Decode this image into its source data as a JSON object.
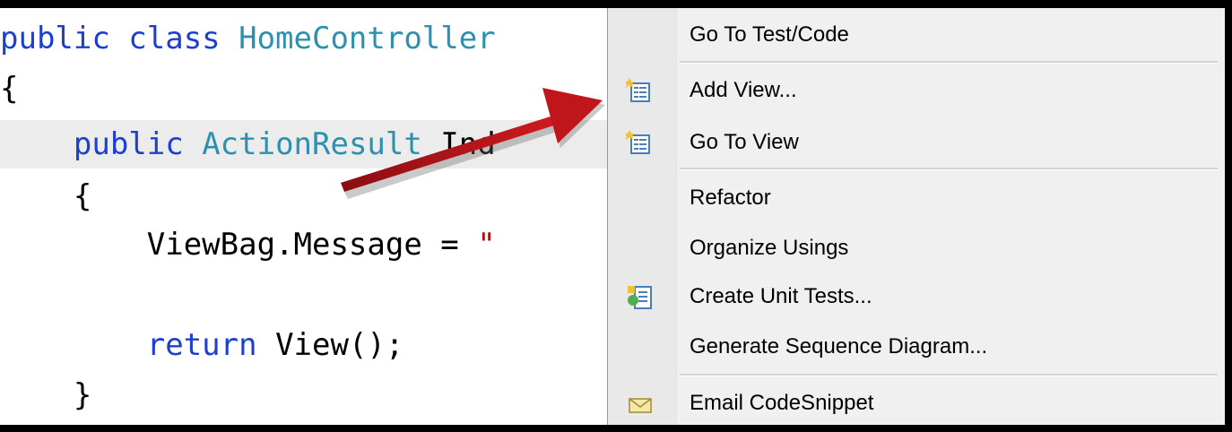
{
  "code": {
    "line1_kw": "public class ",
    "line1_type": "HomeControlle",
    "line1_rest": "r",
    "line2": "{",
    "line3_indent": "    ",
    "line3_kw": "public ",
    "line3_type": "ActionResult",
    "line3_rest": " Ind",
    "line4": "    {",
    "line5_code": "        ViewBag.Message = ",
    "line5_str": "\"",
    "line7_indent": "        ",
    "line7_kw": "return",
    "line7_rest": " View();",
    "line8": "    }"
  },
  "context_menu": {
    "items": [
      {
        "label": "Go To Test/Code",
        "icon": "none"
      },
      {
        "label": "Add View...",
        "icon": "add-view-icon"
      },
      {
        "label": "Go To View",
        "icon": "go-to-view-icon"
      },
      {
        "label": "Refactor",
        "icon": "none"
      },
      {
        "label": "Organize Usings",
        "icon": "none"
      },
      {
        "label": "Create Unit Tests...",
        "icon": "unit-test-icon"
      },
      {
        "label": "Generate Sequence Diagram...",
        "icon": "none"
      },
      {
        "label": "Email CodeSnippet",
        "icon": "envelope-icon"
      }
    ]
  },
  "colors": {
    "keyword": "#1c3fd1",
    "type": "#2b91af",
    "arrow": "#c0161b",
    "menu_background": "#f0f0f0"
  }
}
